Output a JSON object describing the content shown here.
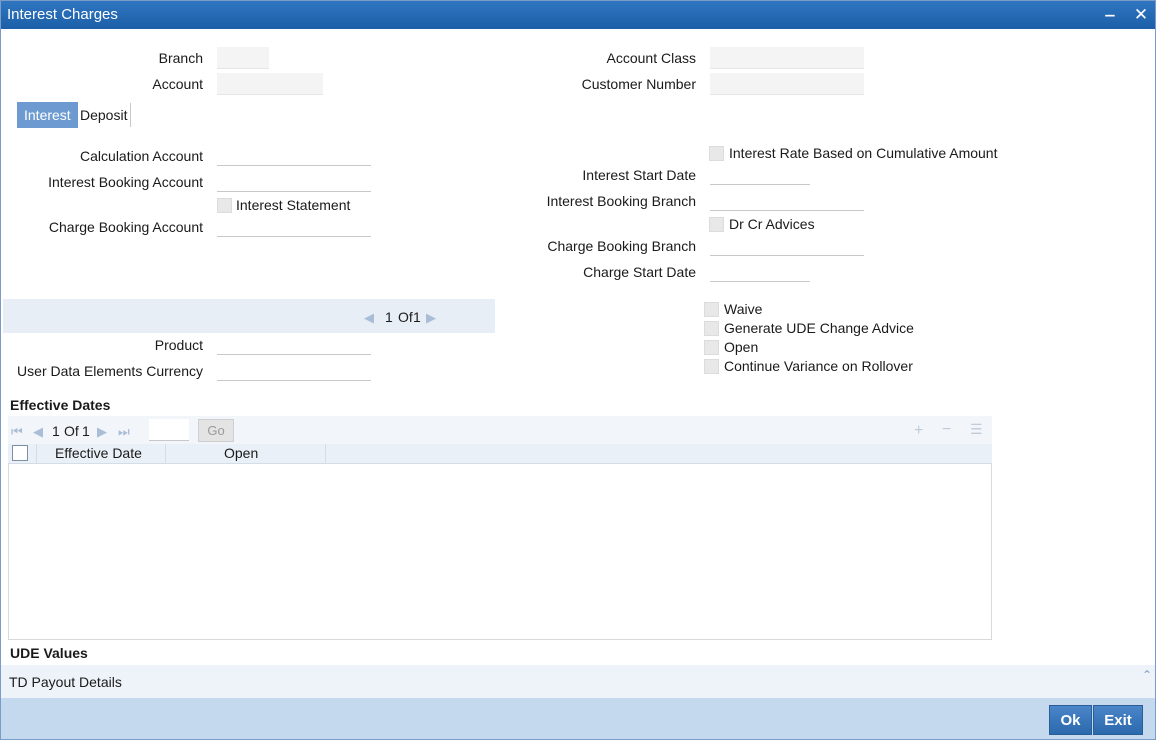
{
  "window": {
    "title": "Interest Charges",
    "minimize_glyph": "‒",
    "close_glyph": "✕"
  },
  "header": {
    "branch_label": "Branch",
    "branch_value": "",
    "account_label": "Account",
    "account_value": "",
    "account_class_label": "Account Class",
    "account_class_value": "",
    "customer_number_label": "Customer Number",
    "customer_number_value": ""
  },
  "tabs": [
    {
      "label": "Interest",
      "active": true
    },
    {
      "label": "Deposit",
      "active": false
    }
  ],
  "interest": {
    "calculation_account_label": "Calculation Account",
    "interest_booking_account_label": "Interest Booking Account",
    "interest_statement_label": "Interest Statement",
    "charge_booking_account_label": "Charge Booking Account",
    "interest_rate_cumulative_label": "Interest Rate Based on Cumulative Amount",
    "interest_start_date_label": "Interest Start Date",
    "interest_booking_branch_label": "Interest Booking Branch",
    "dr_cr_advices_label": "Dr Cr Advices",
    "charge_booking_branch_label": "Charge Booking Branch",
    "charge_start_date_label": "Charge Start Date"
  },
  "product_pager": {
    "current": "1",
    "of_label": "Of",
    "total": "1"
  },
  "product": {
    "product_label": "Product",
    "ude_currency_label": "User Data Elements Currency",
    "waive_label": "Waive",
    "generate_ude_label": "Generate UDE Change Advice",
    "open_label": "Open",
    "continue_variance_label": "Continue Variance on Rollover"
  },
  "effective_dates": {
    "title": "Effective Dates",
    "pager": {
      "current": "1",
      "of_label": "Of",
      "total": "1",
      "go_label": "Go",
      "page_input": ""
    },
    "columns": [
      "Effective Date",
      "Open"
    ],
    "rows": []
  },
  "ude_values": {
    "title": "UDE Values"
  },
  "td_payout": {
    "label": "TD Payout Details"
  },
  "footer": {
    "ok_label": "Ok",
    "exit_label": "Exit"
  },
  "icons": {
    "first_page": "first-page-icon",
    "prev_page": "prev-page-icon",
    "next_page": "next-page-icon",
    "last_page": "last-page-icon",
    "add_row": "plus-icon",
    "delete_row": "minus-icon",
    "view_list": "list-icon",
    "collapse": "chevron-up-icon"
  },
  "colors": {
    "titlebar": "#1c5fa8",
    "tab_active": "#6d9bd1",
    "footer_bar": "#c4d9ee",
    "button": "#2b69ad"
  }
}
